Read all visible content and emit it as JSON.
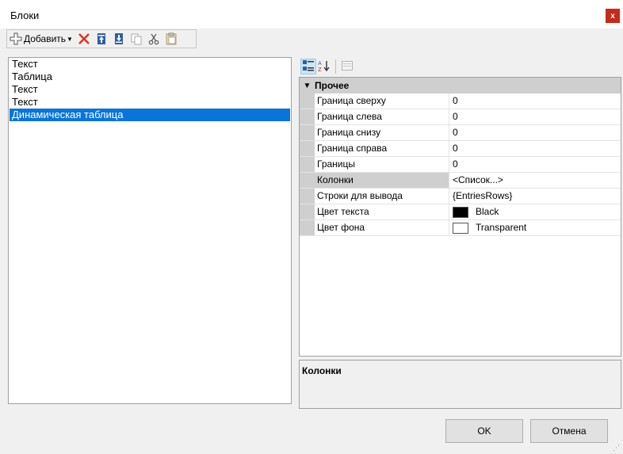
{
  "window": {
    "title": "Блоки",
    "close_label": "x"
  },
  "toolbar": {
    "add_label": "Добавить",
    "icons": [
      "add-icon",
      "delete-icon",
      "move-up-icon",
      "move-down-icon",
      "copy-icon",
      "cut-icon",
      "paste-icon"
    ]
  },
  "blocks": [
    "Текст",
    "Таблица",
    "Текст",
    "Текст",
    "Динамическая таблица"
  ],
  "selected_block_index": 4,
  "property_grid": {
    "category": "Прочее",
    "properties": [
      {
        "name": "Граница сверху",
        "value": "0"
      },
      {
        "name": "Граница слева",
        "value": "0"
      },
      {
        "name": "Граница снизу",
        "value": "0"
      },
      {
        "name": "Граница справа",
        "value": "0"
      },
      {
        "name": "Границы",
        "value": "0"
      },
      {
        "name": "Колонки",
        "value": "<Список...>"
      },
      {
        "name": "Строки для вывода",
        "value": "{EntriesRows}"
      },
      {
        "name": "Цвет текста",
        "value": "Black",
        "color": "#000000"
      },
      {
        "name": "Цвет фона",
        "value": "Transparent",
        "color": "#ffffff"
      }
    ],
    "selected_property_index": 5
  },
  "description": {
    "title": "Колонки"
  },
  "buttons": {
    "ok": "OK",
    "cancel": "Отмена"
  },
  "colors": {
    "selection": "#0a74d8",
    "close": "#c42b1c",
    "category": "#cfcfcf"
  }
}
